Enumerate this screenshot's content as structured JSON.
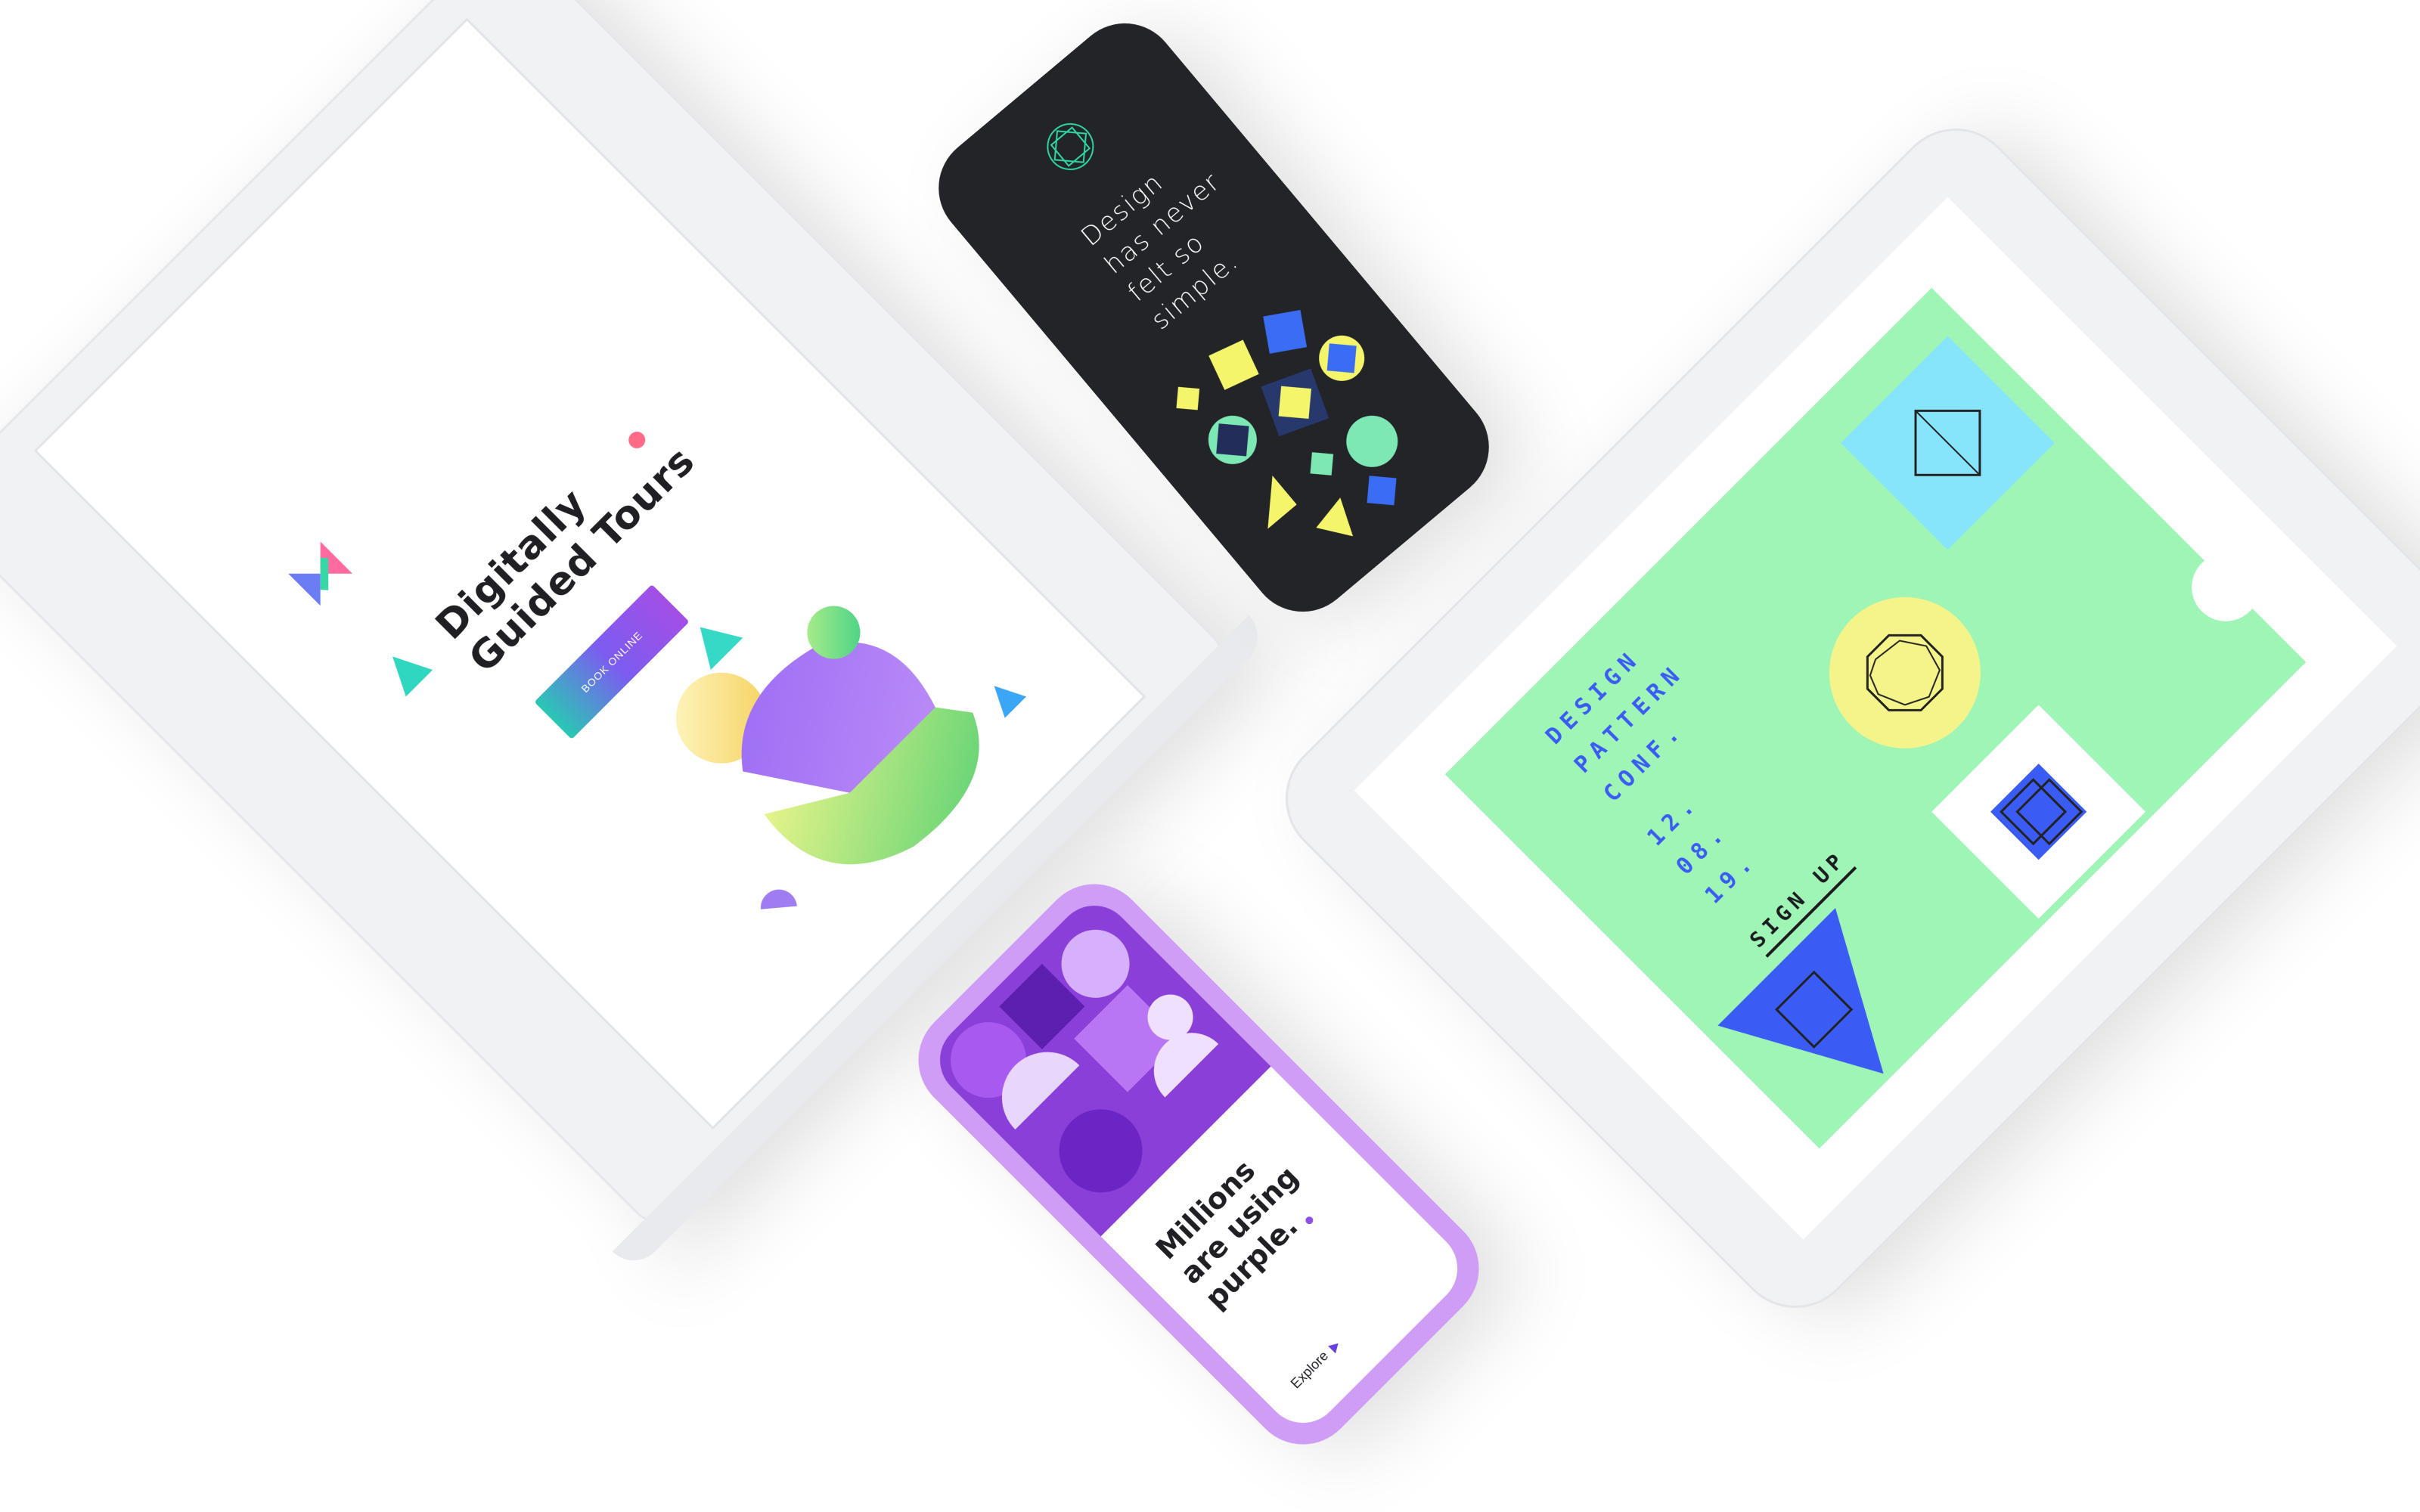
{
  "laptop": {
    "headline_line1": "Digitally",
    "headline_line2": "Guided Tours",
    "book_button": "BOOK ONLINE"
  },
  "dark_phone": {
    "line1": "Design",
    "line2": "has never",
    "line3": "felt so",
    "line4": "simple."
  },
  "tablet": {
    "line1": "DESIGN",
    "line2": "PATTERN",
    "line3": "CONF.",
    "date_day": "12.",
    "date_month": "08.",
    "date_year": "19.",
    "signup": "SIGN UP"
  },
  "purple_phone": {
    "line1": "Millions",
    "line2": "are using",
    "line3": "purple.",
    "explore": "Explore"
  },
  "colors": {
    "accent_teal": "#2fd6c0",
    "accent_purple": "#8e4fe8",
    "tablet_green": "#9ff5b6",
    "tablet_blue": "#3a5cf4",
    "dark_bg": "#232428",
    "purple_frame": "#cf9df6"
  }
}
